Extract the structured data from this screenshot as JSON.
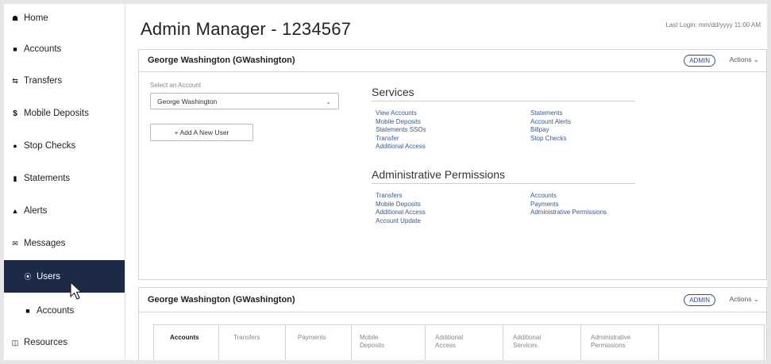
{
  "sidebar": {
    "items": [
      {
        "label": "Home",
        "icon": "home-icon"
      },
      {
        "label": "Accounts",
        "icon": "book-icon"
      },
      {
        "label": "Transfers",
        "icon": "transfer-icon"
      },
      {
        "label": "Mobile Deposits",
        "icon": "dollar-icon"
      },
      {
        "label": "Stop Checks",
        "icon": "alert-circle-icon"
      },
      {
        "label": "Statements",
        "icon": "document-icon"
      },
      {
        "label": "Alerts",
        "icon": "bell-icon"
      },
      {
        "label": "Messages",
        "icon": "envelope-icon"
      },
      {
        "label": "Users",
        "icon": "user-circle-icon",
        "active": true
      },
      {
        "label": "Accounts",
        "icon": "book-icon"
      },
      {
        "label": "Resources",
        "icon": "files-icon"
      }
    ]
  },
  "header": {
    "title": "Admin Manager - 1234567",
    "last_login": "Last Login: mm/dd/yyyy 11:00 AM"
  },
  "user_panel": {
    "name": "George Washington (GWashington)",
    "role_badge": "ADMIN",
    "actions_label": "Actions",
    "select_label": "Select an Account",
    "selected_account": "George Washington",
    "add_user_label": "+ Add A New User",
    "services_title": "Services",
    "services_col1": [
      "View Accounts",
      "Mobile Deposits",
      "Statements SSOs",
      "Transfer",
      "Additional Access"
    ],
    "services_col2": [
      "Statements",
      "Account Alerts",
      "Billpay",
      "Stop Checks"
    ],
    "admin_title": "Administrative Permissions",
    "admin_col1": [
      "Transfers",
      "Mobile Deposits",
      "Additional Access",
      "Account Update"
    ],
    "admin_col2": [
      "Accounts",
      "Payments",
      "Administrative Permissions"
    ]
  },
  "second_panel": {
    "name": "George Washington (GWashington)",
    "role_badge": "ADMIN",
    "actions_label": "Actions",
    "tabs": [
      "Accounts",
      "Transfers",
      "Payments",
      "Mobile Deposits",
      "Additional Access",
      "Additional Services",
      "Administrative Permissions",
      ""
    ]
  },
  "colors": {
    "sidebar_active": "#1c2a48",
    "link": "#3a5a8a",
    "badge": "#2b4f86"
  }
}
